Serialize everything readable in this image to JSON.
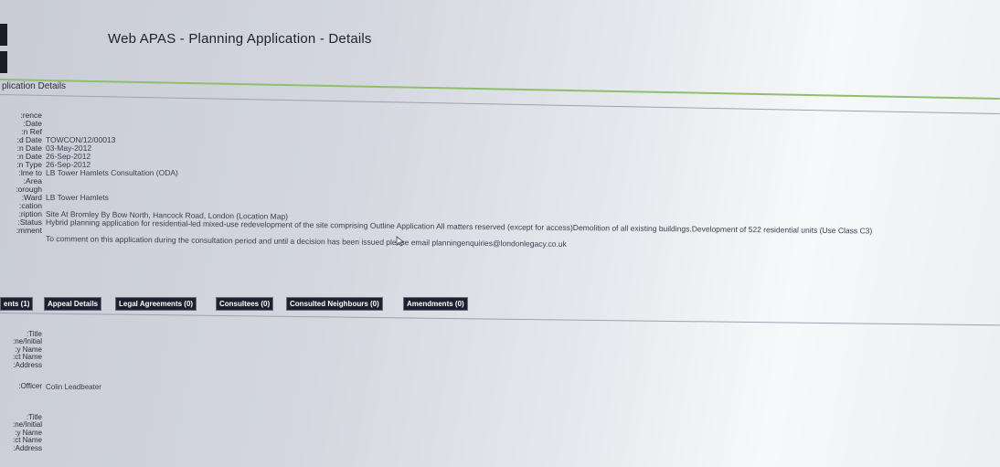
{
  "header": {
    "title": "Web APAS - Planning Application - Details"
  },
  "section": {
    "title": "plication Details"
  },
  "detail_labels": [
    "rence:",
    "Date:",
    "n Ref:",
    "d Date:",
    "n Date:",
    "n Date:",
    "n Type:",
    "lme to:",
    "Area:",
    "orough:",
    "Ward:",
    "cation:",
    "ription:",
    "Status:",
    "mment:"
  ],
  "details": {
    "ref": "TOWCON/12/00013",
    "received_date": "03-May-2012",
    "date1": "26-Sep-2012",
    "date2": "26-Sep-2012",
    "type": "LB Tower Hamlets Consultation (ODA)",
    "borough": "LB Tower Hamlets",
    "location": "Site At Bromley By Bow North, Hancock Road, London (Location Map)",
    "description": "Hybrid planning application for residential-led mixed-use redevelopment of the site comprising Outline Application All matters reserved (except for access)Demolition of all existing buildings.Development of 522 residential units (Use Class C3)",
    "comment": "To comment on this application during the consultation period and until a decision has been issued please email planningenquiries@londonlegacy.co.uk"
  },
  "tabs": [
    "ents (1)",
    "Appeal Details",
    "Legal Agreements (0)",
    "Consultees (0)",
    "Consulted Neighbours (0)",
    "Amendments (0)"
  ],
  "agent_labels": [
    "Title:",
    "ne/Initial:",
    "y Name:",
    "ct Name:",
    "Address:",
    "Officer:"
  ],
  "agent": {
    "officer": "Colin Leadbeater"
  },
  "applicant_labels": [
    "Title:",
    "ne/Initial:",
    "y Name:",
    "ct Name:",
    "Address:"
  ]
}
